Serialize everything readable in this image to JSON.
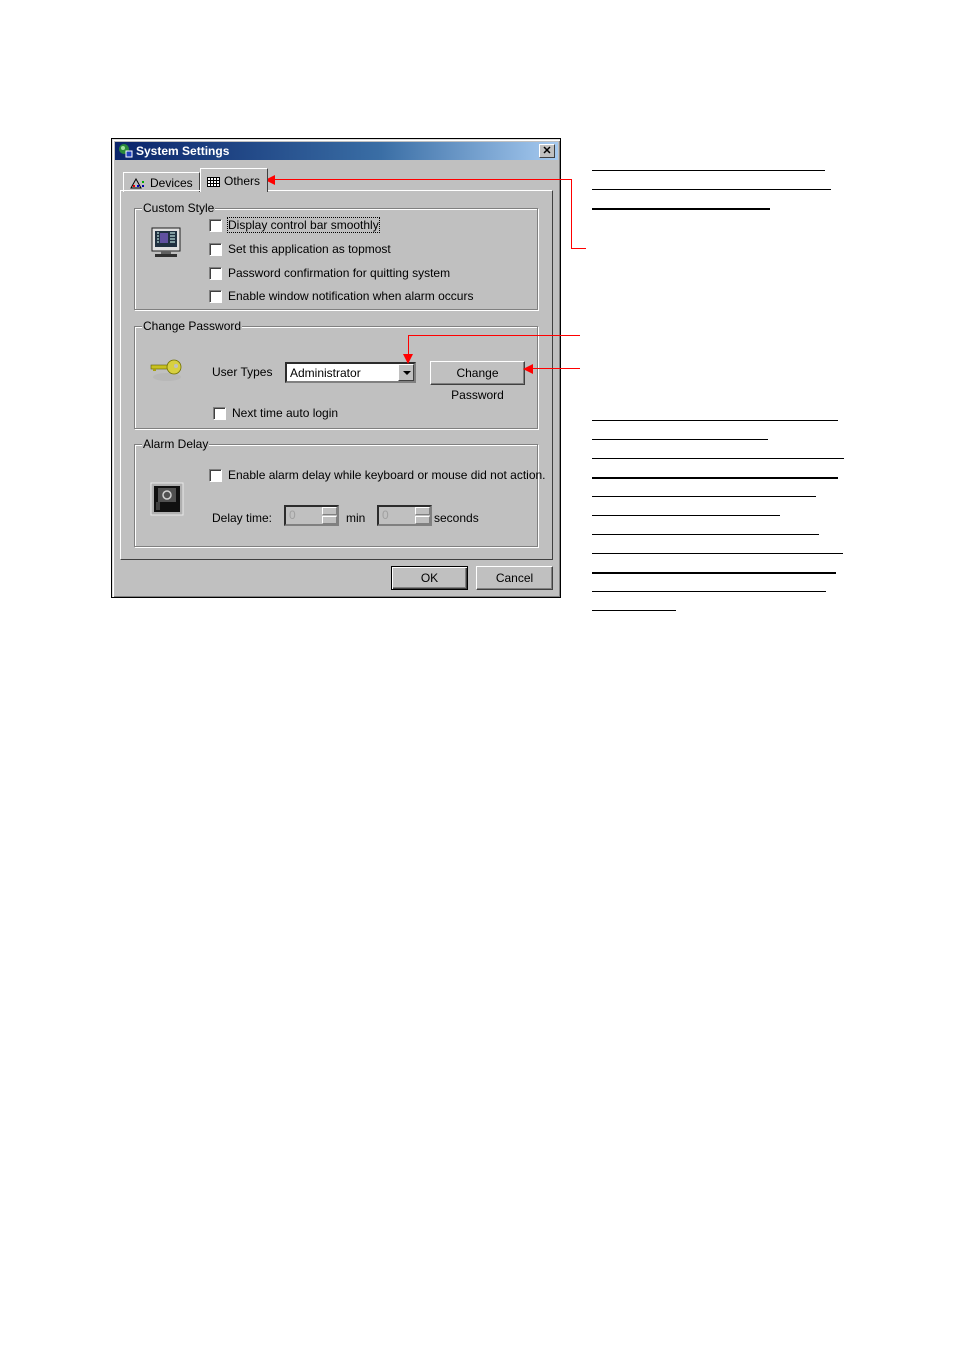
{
  "window": {
    "title": "System Settings",
    "close_label": "✕",
    "tabs": [
      {
        "label": "Devices",
        "icon": "devices-icon",
        "selected": false
      },
      {
        "label": "Others",
        "icon": "grid-icon",
        "selected": true
      }
    ]
  },
  "custom_style": {
    "label": "Custom Style",
    "icon": "monitor-icon",
    "options": [
      {
        "label": "Display control bar smoothly",
        "checked": false,
        "focused": true
      },
      {
        "label": "Set this application as topmost",
        "checked": false
      },
      {
        "label": "Password confirmation for quitting system",
        "checked": false
      },
      {
        "label": "Enable window notification when alarm occurs",
        "checked": false
      }
    ]
  },
  "change_password": {
    "label": "Change Password",
    "icon": "key-icon",
    "user_types_label": "User Types",
    "user_type_value": "Administrator",
    "change_button": "Change Password",
    "auto_login": {
      "label": "Next time auto login",
      "checked": false
    }
  },
  "alarm_delay": {
    "label": "Alarm Delay",
    "icon": "alarm-icon",
    "enable": {
      "label": "Enable alarm delay while keyboard or mouse did not action.",
      "checked": false
    },
    "delay_time_label": "Delay time:",
    "min_value": "0",
    "min_unit": "min",
    "sec_value": "0",
    "sec_unit": "seconds"
  },
  "footer": {
    "ok": "OK",
    "cancel": "Cancel"
  },
  "annotation_color": "#ff0000"
}
